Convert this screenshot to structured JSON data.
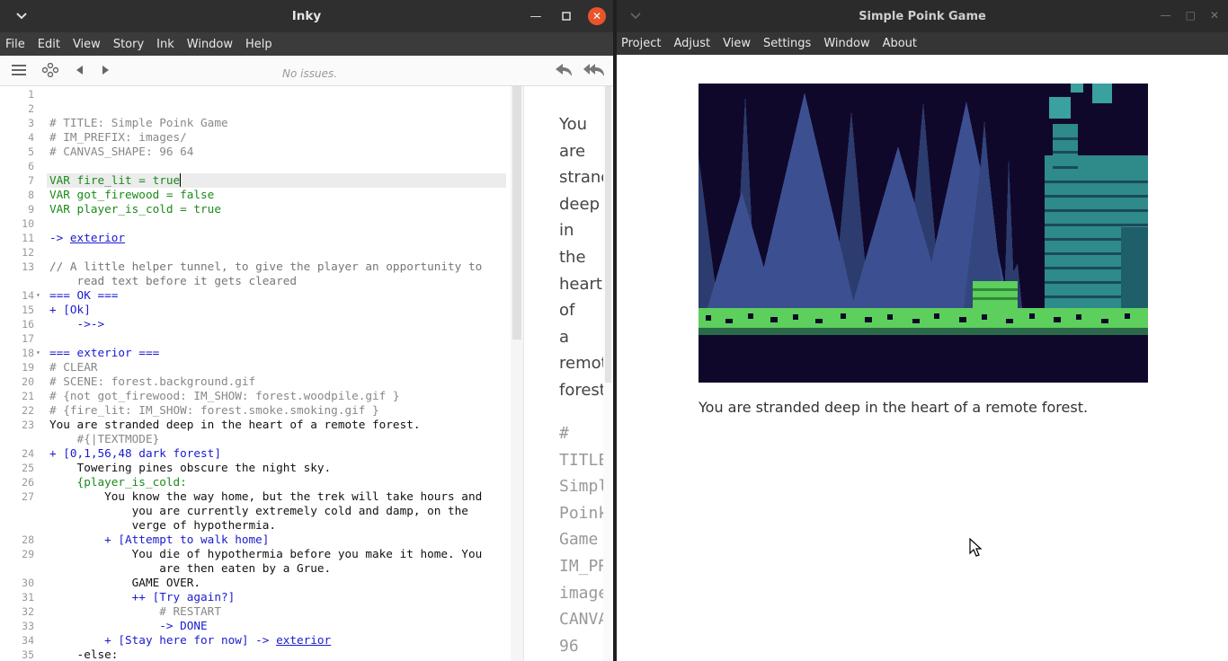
{
  "inky": {
    "title": "Inky",
    "menu": [
      "File",
      "Edit",
      "View",
      "Story",
      "Ink",
      "Window",
      "Help"
    ],
    "issues": "No issues.",
    "lines": [
      {
        "n": "1",
        "t": ""
      },
      {
        "n": "2",
        "t": ""
      },
      {
        "n": "3",
        "t": "# TITLE: Simple Poink Game",
        "c": "comment"
      },
      {
        "n": "4",
        "t": "# IM_PREFIX: images/",
        "c": "comment"
      },
      {
        "n": "5",
        "t": "# CANVAS_SHAPE: 96 64",
        "c": "comment"
      },
      {
        "n": "6",
        "t": ""
      },
      {
        "n": "7",
        "t": "VAR fire_lit = true",
        "c": "green",
        "hl": true
      },
      {
        "n": "8",
        "t": "VAR got_firewood = false",
        "c": "green"
      },
      {
        "n": "9",
        "t": "VAR player_is_cold = true",
        "c": "green"
      },
      {
        "n": "10",
        "t": ""
      },
      {
        "n": "11",
        "t": "-> ",
        "c": "blue",
        "link": "exterior"
      },
      {
        "n": "12",
        "t": ""
      },
      {
        "n": "13",
        "t": "// A little helper tunnel, to give the player an opportunity to",
        "c": "gray"
      },
      {
        "n": "",
        "t": "    read text before it gets cleared",
        "c": "gray"
      },
      {
        "n": "14",
        "t": "=== OK ===",
        "c": "blue",
        "fold": true
      },
      {
        "n": "15",
        "t": "+ [Ok]",
        "c": "blue"
      },
      {
        "n": "16",
        "t": "    ->->",
        "c": "blue"
      },
      {
        "n": "17",
        "t": ""
      },
      {
        "n": "18",
        "t": "=== exterior ===",
        "c": "blue",
        "fold": true
      },
      {
        "n": "19",
        "t": "# CLEAR",
        "c": "comment"
      },
      {
        "n": "20",
        "t": "# SCENE: forest.background.gif",
        "c": "comment"
      },
      {
        "n": "21",
        "t": "# {not got_firewood: IM_SHOW: forest.woodpile.gif }",
        "c": "comment"
      },
      {
        "n": "22",
        "t": "# {fire_lit: IM_SHOW: forest.smoke.smoking.gif }",
        "c": "comment"
      },
      {
        "n": "23",
        "t": "You are stranded deep in the heart of a remote forest."
      },
      {
        "n": "",
        "t": "    #{|TEXTMODE}",
        "c": "comment"
      },
      {
        "n": "24",
        "t": "+ [0,1,56,48 dark forest]",
        "c": "blue"
      },
      {
        "n": "25",
        "t": "    Towering pines obscure the night sky."
      },
      {
        "n": "26",
        "t": "    {player_is_cold:",
        "c": "green"
      },
      {
        "n": "27",
        "t": "        You know the way home, but the trek will take hours and"
      },
      {
        "n": "",
        "t": "            you are currently extremely cold and damp, on the"
      },
      {
        "n": "",
        "t": "            verge of hypothermia."
      },
      {
        "n": "28",
        "t": "        + [Attempt to walk home]",
        "c": "blue"
      },
      {
        "n": "29",
        "t": "            You die of hypothermia before you make it home. You"
      },
      {
        "n": "",
        "t": "                are then eaten by a Grue."
      },
      {
        "n": "30",
        "t": "            GAME OVER."
      },
      {
        "n": "31",
        "t": "            ++ [Try again?]",
        "c": "blue"
      },
      {
        "n": "32",
        "t": "                # RESTART",
        "c": "comment"
      },
      {
        "n": "33",
        "t": "                -> DONE",
        "c": "blue"
      },
      {
        "n": "34",
        "t": "        + [Stay here for now] -> ",
        "c": "blue",
        "link": "exterior"
      },
      {
        "n": "35",
        "t": "    -else:"
      }
    ],
    "preview_words": [
      "You",
      "are",
      "strand",
      "deep",
      "in",
      "the",
      "heart",
      "of",
      "a",
      "remot",
      "forest"
    ],
    "preview_words2": [
      "#",
      "TITLE",
      "Simpl",
      "Poink",
      "Game",
      "IM_PR",
      "image",
      "CANVA",
      "96"
    ]
  },
  "game": {
    "title": "Simple Poink Game",
    "menu": [
      "Project",
      "Adjust",
      "View",
      "Settings",
      "Window",
      "About"
    ],
    "text": "You are stranded deep in the heart of a remote forest.",
    "colors": {
      "sky": "#10082a",
      "tree": "#2c3c6e",
      "tree_light": "#3c4f90",
      "grass": "#5ccf5c",
      "cabin": "#2f8a8a",
      "smoke": "#3aa0a0"
    }
  }
}
